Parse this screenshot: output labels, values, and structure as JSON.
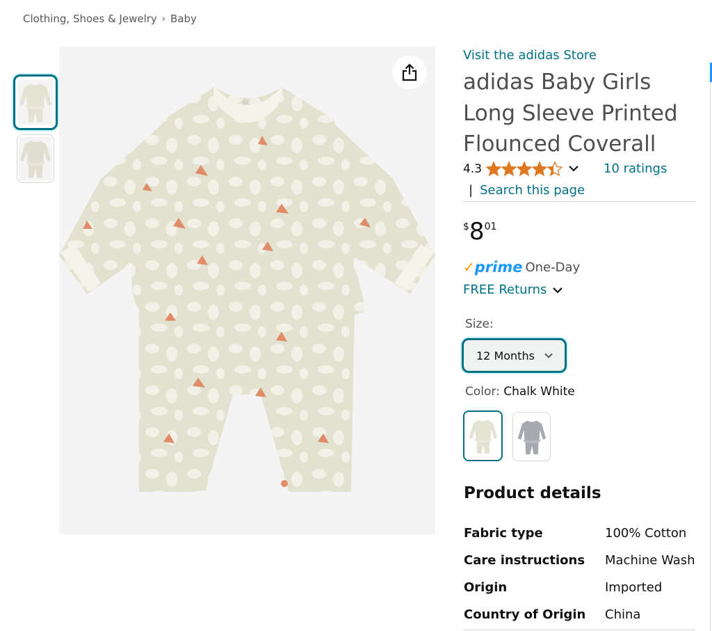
{
  "breadcrumb": {
    "items": [
      "Clothing, Shoes & Jewelry",
      "Baby"
    ],
    "separator": "›"
  },
  "product": {
    "store_link": "Visit the adidas Store",
    "title": "adidas Baby Girls Long Sleeve Printed Flounced Coverall",
    "rating_value": "4.3",
    "rating_stars": 4.3,
    "ratings_count": "10 ratings",
    "search_pipe": "|",
    "search_link": "Search this page",
    "price": {
      "symbol": "$",
      "whole": "8",
      "fraction": "01"
    },
    "prime": {
      "check": "✓",
      "label": "prime",
      "delivery": "One-Day"
    },
    "returns": "FREE Returns",
    "size": {
      "label": "Size:",
      "selected": "12 Months"
    },
    "color": {
      "label": "Color:",
      "selected": "Chalk White"
    }
  },
  "details": {
    "title": "Product details",
    "rows": [
      {
        "key": "Fabric type",
        "value": "100% Cotton"
      },
      {
        "key": "Care instructions",
        "value": "Machine Wash"
      },
      {
        "key": "Origin",
        "value": "Imported"
      },
      {
        "key": "Country of Origin",
        "value": "China"
      }
    ]
  },
  "colors": {
    "link": "#007185",
    "star": "#de7921",
    "prime_blue": "#1a98ff",
    "prime_check": "#ff9900",
    "garment": "#e4e2d2",
    "garment_pattern": "#f2f1e8",
    "garment_trim": "#f5f3ea",
    "accent_print": "#e08c68"
  },
  "icons": {
    "share": "share-icon",
    "chevron": "chevron-down-icon",
    "star": "star-icon"
  }
}
